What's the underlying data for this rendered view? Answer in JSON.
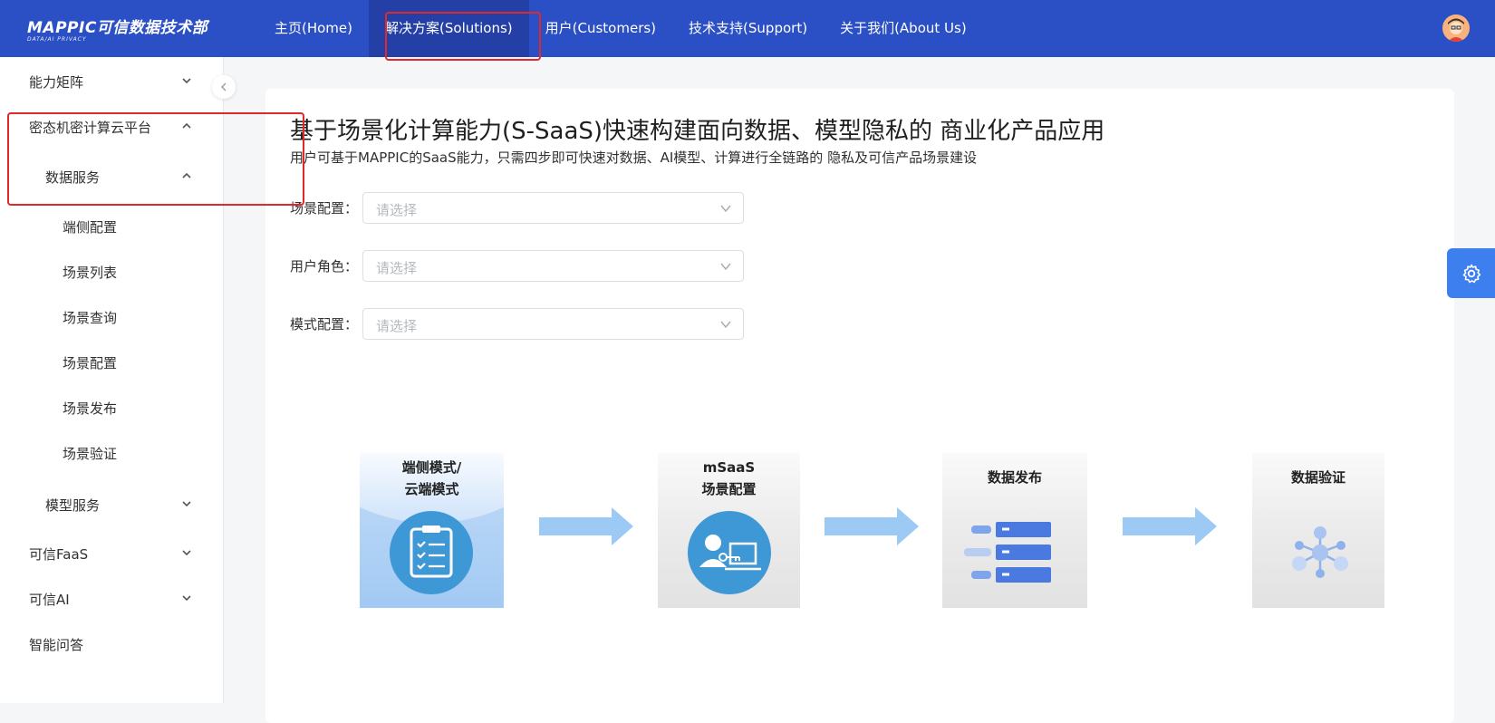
{
  "brand": {
    "name": "MAPPIC可信数据技术部",
    "tagline": "DATA/AI PRIVACY"
  },
  "nav": [
    "主页(Home)",
    "解决方案(Solutions)",
    "用户(Customers)",
    "技术支持(Support)",
    "关于我们(About Us)"
  ],
  "sidebar": {
    "capability": "能力矩阵",
    "platform": "密态机密计算云平台",
    "data_service": "数据服务",
    "data_children": [
      "端侧配置",
      "场景列表",
      "场景查询",
      "场景配置",
      "场景发布",
      "场景验证"
    ],
    "model_service": "模型服务",
    "faas": "可信FaaS",
    "ai": "可信AI",
    "qa": "智能问答"
  },
  "page": {
    "title": "基于场景化计算能力(S-SaaS)快速构建面向数据、模型隐私的 商业化产品应用",
    "subtitle": "用户可基于MAPPIC的SaaS能力，只需四步即可快速对数据、AI模型、计算进行全链路的 隐私及可信产品场景建设"
  },
  "form": {
    "scene_label": "场景配置：",
    "role_label": "用户角色：",
    "mode_label": "模式配置：",
    "placeholder": "请选择"
  },
  "steps": {
    "s1": "端侧模式/",
    "s1b": "云端模式",
    "s2": "mSaaS",
    "s2b": "场景配置",
    "s3": "数据发布",
    "s4": "数据验证"
  },
  "icons": {
    "chevron": "chevron-icon",
    "collapse": "chevron-left-icon",
    "settings": "gear-icon",
    "clipboard": "clipboard-icon",
    "user_key": "user-key-icon",
    "server": "server-icon",
    "network": "network-icon"
  },
  "colors": {
    "header": "#2b4fc4",
    "header_active": "#2440a6",
    "accent": "#3e7ff0",
    "highlight": "#e0292a",
    "arrow": "#9ccaf5"
  }
}
